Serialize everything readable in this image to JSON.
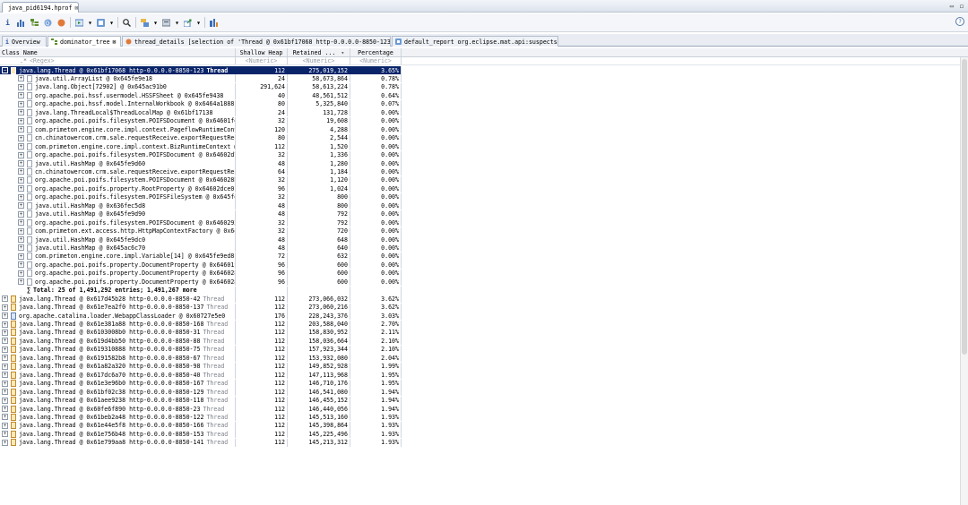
{
  "editor_tab": {
    "label": "java_pid6194.hprof",
    "close": "⊠"
  },
  "window_controls": {
    "minimize": "▭",
    "maximize": "◻"
  },
  "toolbar": {
    "help": "?"
  },
  "view_tabs": [
    {
      "label": "Overview"
    },
    {
      "label": "dominator_tree",
      "close": "⊠"
    },
    {
      "label": "thread_details [selection of 'Thread @ 0x61bf17068  http-0.0.0.0-8850-123']"
    },
    {
      "label": "default_report  org.eclipse.mat.api:suspects"
    }
  ],
  "columns": {
    "name": "Class Name",
    "shallow": "Shallow Heap",
    "retained": "Retained ...",
    "percentage": "Percentage"
  },
  "regex_row": {
    "name": "<Regex>",
    "shallow": "<Numeric>",
    "retained": "<Numeric>",
    "percentage": "<Numeric>"
  },
  "selected_row": {
    "toggle": "−",
    "name": "java.lang.Thread @ 0x61bf17068  http-0.0.0.0-8850-123",
    "label": "Thread",
    "shallow": "112",
    "retained": "275,019,152",
    "percentage": "3.65%"
  },
  "children": [
    {
      "name": "java.util.ArrayList @ 0x645fe9e18",
      "shallow": "24",
      "retained": "58,673,864",
      "percentage": "0.78%"
    },
    {
      "name": "java.lang.Object[72902] @ 0x645ac91b0",
      "shallow": "291,624",
      "retained": "58,613,224",
      "percentage": "0.78%"
    },
    {
      "name": "org.apache.poi.hssf.usermodel.HSSFSheet @ 0x645fe9438",
      "shallow": "40",
      "retained": "48,561,512",
      "percentage": "0.64%"
    },
    {
      "name": "org.apache.poi.hssf.model.InternalWorkbook @ 0x6464a1888",
      "shallow": "80",
      "retained": "5,325,840",
      "percentage": "0.07%"
    },
    {
      "name": "java.lang.ThreadLocal$ThreadLocalMap @ 0x61bf17138",
      "shallow": "24",
      "retained": "131,728",
      "percentage": "0.00%"
    },
    {
      "name": "org.apache.poi.poifs.filesystem.POIFSDocument @ 0x64601fef",
      "shallow": "32",
      "retained": "19,608",
      "percentage": "0.00%"
    },
    {
      "name": "com.primeton.engine.core.impl.context.PageflowRuntimeConte",
      "shallow": "120",
      "retained": "4,288",
      "percentage": "0.00%"
    },
    {
      "name": "cn.chinatowercom.crm.sale.requestReceive.exportRequestRece",
      "shallow": "80",
      "retained": "2,544",
      "percentage": "0.00%"
    },
    {
      "name": "com.primeton.engine.core.impl.context.BizRuntimeContext @",
      "shallow": "112",
      "retained": "1,520",
      "percentage": "0.00%"
    },
    {
      "name": "org.apache.poi.poifs.filesystem.POIFSDocument @ 0x64602d7a",
      "shallow": "32",
      "retained": "1,336",
      "percentage": "0.00%"
    },
    {
      "name": "java.util.HashMap @ 0x645fe9d60",
      "shallow": "48",
      "retained": "1,280",
      "percentage": "0.00%"
    },
    {
      "name": "cn.chinatowercom.crm.sale.requestReceive.exportRequestRece",
      "shallow": "64",
      "retained": "1,184",
      "percentage": "0.00%"
    },
    {
      "name": "org.apache.poi.poifs.filesystem.POIFSDocument @ 0x646028b7",
      "shallow": "32",
      "retained": "1,120",
      "percentage": "0.00%"
    },
    {
      "name": "org.apache.poi.poifs.property.RootProperty @ 0x64602dce0",
      "shallow": "96",
      "retained": "1,024",
      "percentage": "0.00%"
    },
    {
      "name": "org.apache.poi.poifs.filesystem.POIFSFileSystem @ 0x645fe9",
      "shallow": "32",
      "retained": "800",
      "percentage": "0.00%"
    },
    {
      "name": "java.util.HashMap @ 0x636fec5d8",
      "shallow": "48",
      "retained": "800",
      "percentage": "0.00%"
    },
    {
      "name": "java.util.HashMap @ 0x645fe9d90",
      "shallow": "48",
      "retained": "792",
      "percentage": "0.00%"
    },
    {
      "name": "org.apache.poi.poifs.filesystem.POIFSDocument @ 0x64602928",
      "shallow": "32",
      "retained": "792",
      "percentage": "0.00%"
    },
    {
      "name": "com.primeton.ext.access.http.HttpMapContextFactory @ 0x645",
      "shallow": "32",
      "retained": "720",
      "percentage": "0.00%"
    },
    {
      "name": "java.util.HashMap @ 0x645fe9dc0",
      "shallow": "48",
      "retained": "648",
      "percentage": "0.00%"
    },
    {
      "name": "java.util.HashMap @ 0x645ac6c70",
      "shallow": "48",
      "retained": "640",
      "percentage": "0.00%"
    },
    {
      "name": "com.primeton.engine.core.impl.Variable[14] @ 0x645fe9ed8",
      "shallow": "72",
      "retained": "632",
      "percentage": "0.00%"
    },
    {
      "name": "org.apache.poi.poifs.property.DocumentProperty @ 0x64601fc",
      "shallow": "96",
      "retained": "600",
      "percentage": "0.00%"
    },
    {
      "name": "org.apache.poi.poifs.property.DocumentProperty @ 0x6460288",
      "shallow": "96",
      "retained": "600",
      "percentage": "0.00%"
    },
    {
      "name": "org.apache.poi.poifs.property.DocumentProperty @ 0x646028f",
      "shallow": "96",
      "retained": "600",
      "percentage": "0.00%"
    }
  ],
  "total_row": {
    "sigma": "∑",
    "text": "Total: 25 of 1,491,292 entries; 1,491,267 more"
  },
  "top_rows": [
    {
      "name": "java.lang.Thread @ 0x617d45b28  http-0.0.0.0-8850-42",
      "label": "Thread",
      "shallow": "112",
      "retained": "273,066,032",
      "percentage": "3.62%",
      "icon": "thread"
    },
    {
      "name": "java.lang.Thread @ 0x61e7ea2f0  http-0.0.0.0-8850-137",
      "label": "Thread",
      "shallow": "112",
      "retained": "273,060,216",
      "percentage": "3.62%",
      "icon": "thread"
    },
    {
      "name": "org.apache.catalina.loader.WebappClassLoader @ 0x60727e5e0",
      "label": "",
      "shallow": "176",
      "retained": "228,243,376",
      "percentage": "3.03%",
      "icon": "classloader"
    },
    {
      "name": "java.lang.Thread @ 0x61e381a88  http-0.0.0.0-8850-168",
      "label": "Thread",
      "shallow": "112",
      "retained": "203,588,040",
      "percentage": "2.70%",
      "icon": "thread"
    },
    {
      "name": "java.lang.Thread @ 0x6103008b0  http-0.0.0.0-8850-31",
      "label": "Thread",
      "shallow": "112",
      "retained": "158,830,952",
      "percentage": "2.11%",
      "icon": "thread"
    },
    {
      "name": "java.lang.Thread @ 0x619d4bb50  http-0.0.0.0-8850-88",
      "label": "Thread",
      "shallow": "112",
      "retained": "158,036,664",
      "percentage": "2.10%",
      "icon": "thread"
    },
    {
      "name": "java.lang.Thread @ 0x619310888  http-0.0.0.0-8850-75",
      "label": "Thread",
      "shallow": "112",
      "retained": "157,923,344",
      "percentage": "2.10%",
      "icon": "thread"
    },
    {
      "name": "java.lang.Thread @ 0x6191582b8  http-0.0.0.0-8850-67",
      "label": "Thread",
      "shallow": "112",
      "retained": "153,932,080",
      "percentage": "2.04%",
      "icon": "thread"
    },
    {
      "name": "java.lang.Thread @ 0x61a82a320  http-0.0.0.0-8850-98",
      "label": "Thread",
      "shallow": "112",
      "retained": "149,852,928",
      "percentage": "1.99%",
      "icon": "thread"
    },
    {
      "name": "java.lang.Thread @ 0x617dc6a70  http-0.0.0.0-8850-40",
      "label": "Thread",
      "shallow": "112",
      "retained": "147,113,968",
      "percentage": "1.95%",
      "icon": "thread"
    },
    {
      "name": "java.lang.Thread @ 0x61e3e96b0  http-0.0.0.0-8850-167",
      "label": "Thread",
      "shallow": "112",
      "retained": "146,710,176",
      "percentage": "1.95%",
      "icon": "thread"
    },
    {
      "name": "java.lang.Thread @ 0x61bf02c38  http-0.0.0.0-8850-129",
      "label": "Thread",
      "shallow": "112",
      "retained": "146,541,080",
      "percentage": "1.94%",
      "icon": "thread"
    },
    {
      "name": "java.lang.Thread @ 0x61aee9238  http-0.0.0.0-8850-118",
      "label": "Thread",
      "shallow": "112",
      "retained": "146,455,152",
      "percentage": "1.94%",
      "icon": "thread"
    },
    {
      "name": "java.lang.Thread @ 0x60fe6f890  http-0.0.0.0-8850-23",
      "label": "Thread",
      "shallow": "112",
      "retained": "146,440,056",
      "percentage": "1.94%",
      "icon": "thread"
    },
    {
      "name": "java.lang.Thread @ 0x61beb2a48  http-0.0.0.0-8850-122",
      "label": "Thread",
      "shallow": "112",
      "retained": "145,513,160",
      "percentage": "1.93%",
      "icon": "thread"
    },
    {
      "name": "java.lang.Thread @ 0x61e44e5f8  http-0.0.0.0-8850-166",
      "label": "Thread",
      "shallow": "112",
      "retained": "145,398,864",
      "percentage": "1.93%",
      "icon": "thread"
    },
    {
      "name": "java.lang.Thread @ 0x61e756b48  http-0.0.0.0-8850-153",
      "label": "Thread",
      "shallow": "112",
      "retained": "145,225,496",
      "percentage": "1.93%",
      "icon": "thread"
    },
    {
      "name": "java.lang.Thread @ 0x61e799aa8  http-0.0.0.0-8850-141",
      "label": "Thread",
      "shallow": "112",
      "retained": "145,213,312",
      "percentage": "1.93%",
      "icon": "thread"
    }
  ]
}
